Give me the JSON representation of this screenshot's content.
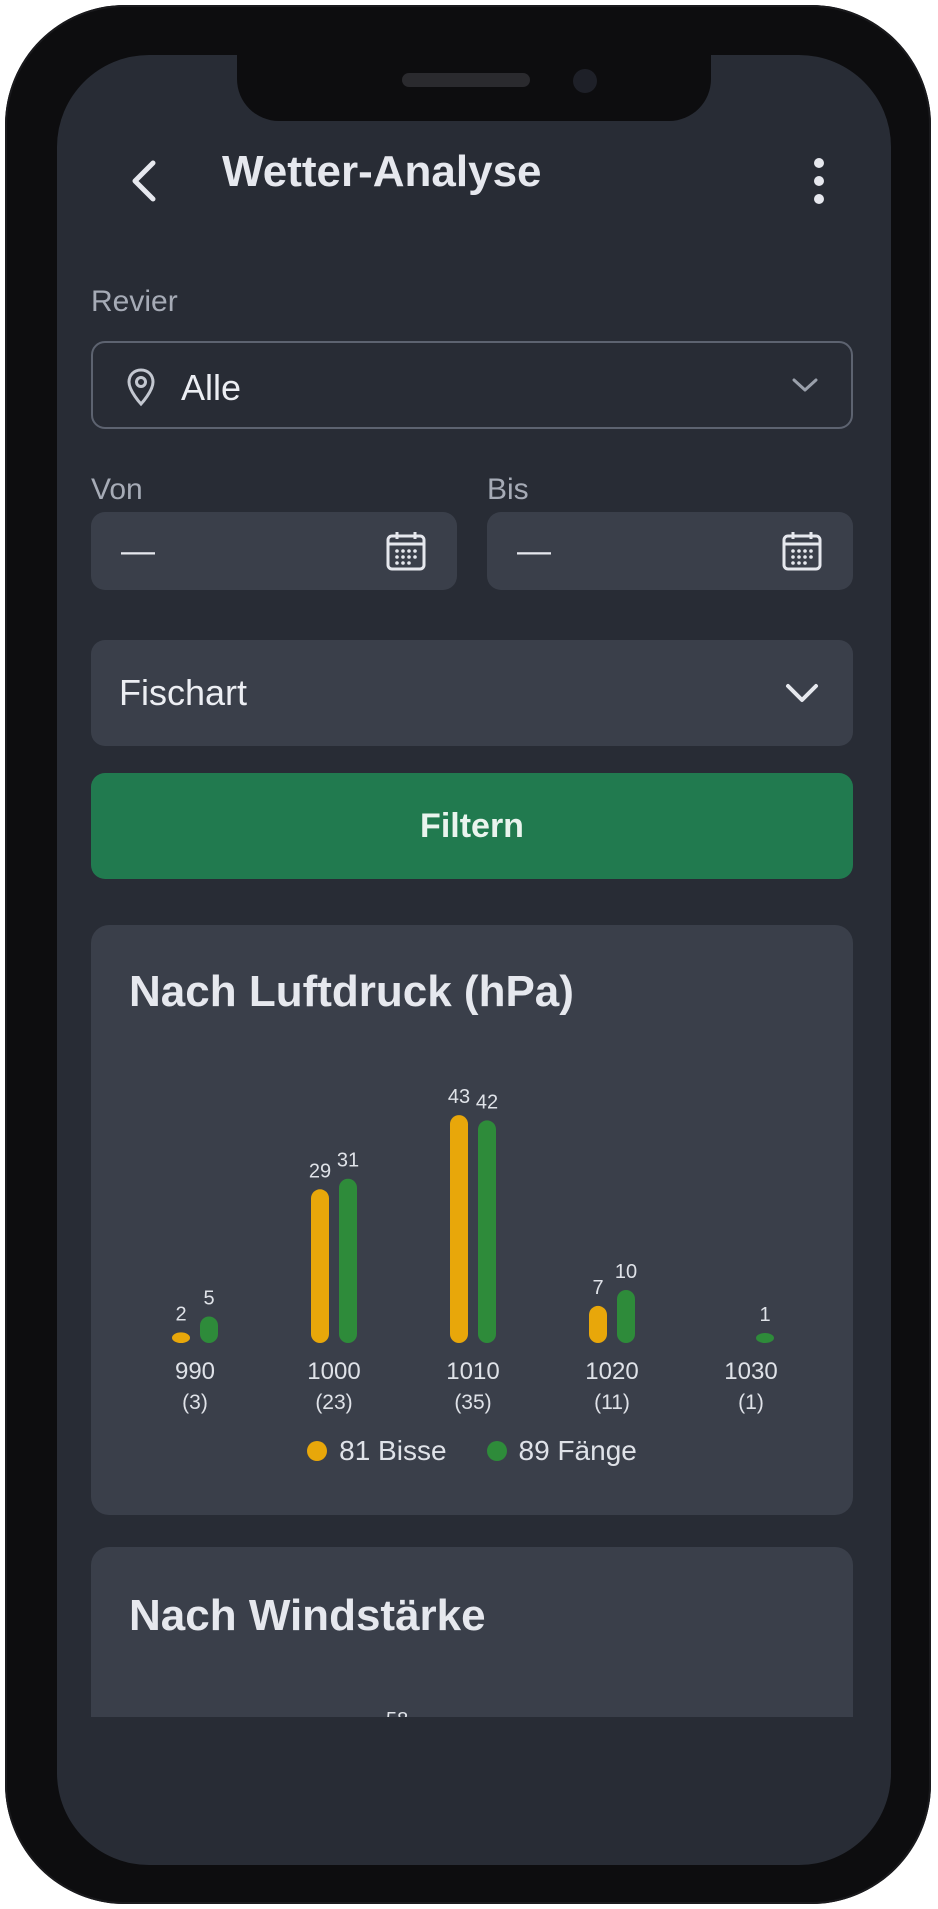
{
  "header": {
    "title": "Wetter-Analyse"
  },
  "filters": {
    "revier_label": "Revier",
    "revier_value": "Alle",
    "von_label": "Von",
    "von_value": "—",
    "bis_label": "Bis",
    "bis_value": "—",
    "fischart_label": "Fischart",
    "filter_button": "Filtern"
  },
  "colors": {
    "accent": "#217a4f",
    "bisse": "#e8a70a",
    "faenge": "#2e8b3a"
  },
  "chart_data": {
    "type": "bar",
    "title": "Nach Luftdruck (hPa)",
    "categories": [
      "990",
      "1000",
      "1010",
      "1020",
      "1030"
    ],
    "category_counts": [
      "(3)",
      "(23)",
      "(35)",
      "(11)",
      "(1)"
    ],
    "series": [
      {
        "name": "Bisse",
        "values": [
          2,
          29,
          43,
          7,
          0
        ],
        "value_labels": [
          "2",
          "29",
          "43",
          "7",
          ""
        ]
      },
      {
        "name": "Fänge",
        "values": [
          5,
          31,
          42,
          10,
          1
        ],
        "value_labels": [
          "5",
          "31",
          "42",
          "10",
          "1"
        ]
      }
    ],
    "legend": [
      "81 Bisse",
      "89 Fänge"
    ],
    "legend_position": "bottom"
  },
  "wind_card": {
    "title": "Nach Windstärke",
    "partial_label": "58"
  }
}
